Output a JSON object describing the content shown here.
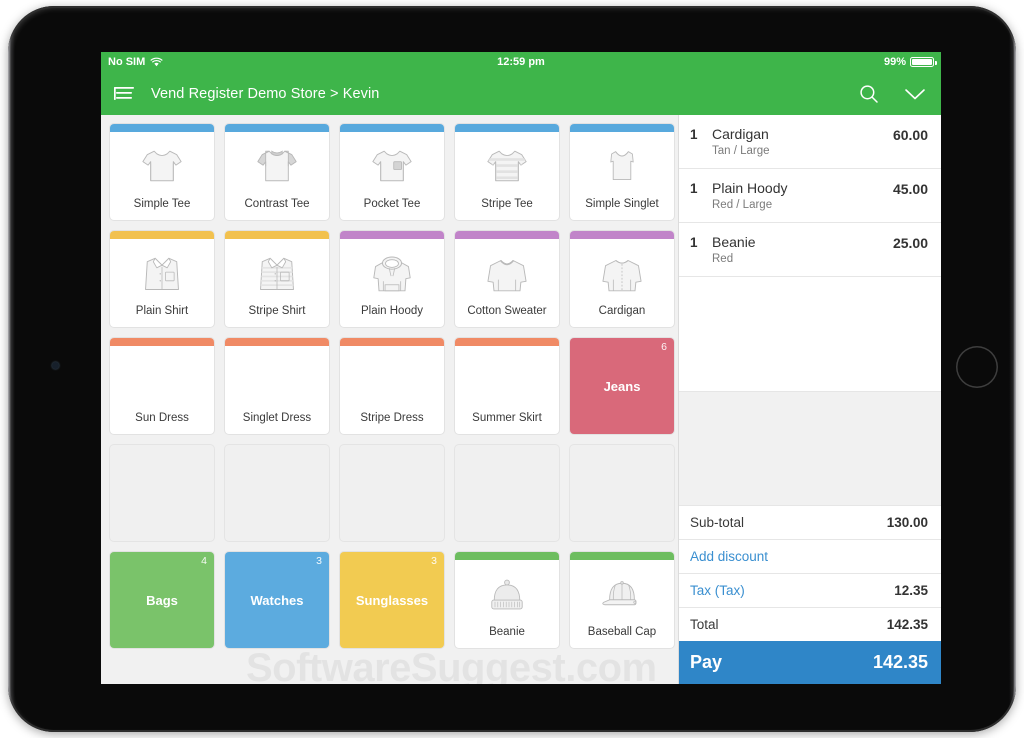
{
  "status_bar": {
    "carrier": "No SIM",
    "wifi_icon": "wifi-icon",
    "time": "12:59 pm",
    "battery_percent": "99%",
    "battery_icon": "battery-icon"
  },
  "nav": {
    "menu_icon": "hamburger-menu-icon",
    "breadcrumb": "Vend Register Demo Store > Kevin",
    "search_icon": "search-icon",
    "chevron_icon": "chevron-down-icon"
  },
  "colors": {
    "brand_green": "#3eb54a",
    "accent_blue": "#58a9dd",
    "accent_yellow": "#f2c14e",
    "accent_purple": "#c184c9",
    "accent_orange": "#f08a65",
    "accent_green": "#6dbd5f",
    "tile_green": "#7ac36a",
    "tile_blue": "#5cabdf",
    "tile_yellow": "#f2cb51",
    "tile_rose": "#d9697a",
    "pay_blue": "#2f86c8",
    "link_blue": "#3a8fd0"
  },
  "grid": {
    "tiles": [
      {
        "label": "Simple Tee",
        "type": "product",
        "accent": "#58a9dd",
        "art": "tee-simple-icon",
        "badge": ""
      },
      {
        "label": "Contrast Tee",
        "type": "product",
        "accent": "#58a9dd",
        "art": "tee-contrast-icon",
        "badge": ""
      },
      {
        "label": "Pocket Tee",
        "type": "product",
        "accent": "#58a9dd",
        "art": "tee-pocket-icon",
        "badge": ""
      },
      {
        "label": "Stripe Tee",
        "type": "product",
        "accent": "#58a9dd",
        "art": "tee-stripe-icon",
        "badge": ""
      },
      {
        "label": "Simple Singlet",
        "type": "product",
        "accent": "#58a9dd",
        "art": "singlet-icon",
        "badge": ""
      },
      {
        "label": "Plain Shirt",
        "type": "product",
        "accent": "#f2c14e",
        "art": "shirt-plain-icon",
        "badge": ""
      },
      {
        "label": "Stripe Shirt",
        "type": "product",
        "accent": "#f2c14e",
        "art": "shirt-stripe-icon",
        "badge": ""
      },
      {
        "label": "Plain Hoody",
        "type": "product",
        "accent": "#c184c9",
        "art": "hoody-icon",
        "badge": ""
      },
      {
        "label": "Cotton Sweater",
        "type": "product",
        "accent": "#c184c9",
        "art": "sweater-icon",
        "badge": ""
      },
      {
        "label": "Cardigan",
        "type": "product",
        "accent": "#c184c9",
        "art": "cardigan-icon",
        "badge": ""
      },
      {
        "label": "Sun Dress",
        "type": "product",
        "accent": "#f08a65",
        "art": "",
        "badge": ""
      },
      {
        "label": "Singlet Dress",
        "type": "product",
        "accent": "#f08a65",
        "art": "",
        "badge": ""
      },
      {
        "label": "Stripe Dress",
        "type": "product",
        "accent": "#f08a65",
        "art": "",
        "badge": ""
      },
      {
        "label": "Summer Skirt",
        "type": "product",
        "accent": "#f08a65",
        "art": "",
        "badge": ""
      },
      {
        "label": "Jeans",
        "type": "group",
        "accent": "#d9697a",
        "art": "",
        "badge": "6"
      },
      {
        "label": "",
        "type": "empty",
        "accent": "",
        "art": "",
        "badge": ""
      },
      {
        "label": "",
        "type": "empty",
        "accent": "",
        "art": "",
        "badge": ""
      },
      {
        "label": "",
        "type": "empty",
        "accent": "",
        "art": "",
        "badge": ""
      },
      {
        "label": "",
        "type": "empty",
        "accent": "",
        "art": "",
        "badge": ""
      },
      {
        "label": "",
        "type": "empty",
        "accent": "",
        "art": "",
        "badge": ""
      },
      {
        "label": "Bags",
        "type": "group",
        "accent": "#7ac36a",
        "art": "",
        "badge": "4"
      },
      {
        "label": "Watches",
        "type": "group",
        "accent": "#5cabdf",
        "art": "",
        "badge": "3"
      },
      {
        "label": "Sunglasses",
        "type": "group",
        "accent": "#f2cb51",
        "art": "",
        "badge": "3"
      },
      {
        "label": "Beanie",
        "type": "product",
        "accent": "#6dbd5f",
        "art": "beanie-icon",
        "badge": ""
      },
      {
        "label": "Baseball Cap",
        "type": "product",
        "accent": "#6dbd5f",
        "art": "cap-icon",
        "badge": ""
      }
    ]
  },
  "cart": {
    "items": [
      {
        "qty": "1",
        "name": "Cardigan",
        "variant": "Tan / Large",
        "price": "60.00"
      },
      {
        "qty": "1",
        "name": "Plain Hoody",
        "variant": "Red / Large",
        "price": "45.00"
      },
      {
        "qty": "1",
        "name": "Beanie",
        "variant": "Red",
        "price": "25.00"
      }
    ],
    "totals": [
      {
        "label": "Sub-total",
        "amount": "130.00",
        "style": "plain"
      },
      {
        "label": "Add discount",
        "amount": "",
        "style": "link"
      },
      {
        "label": "Tax (Tax)",
        "amount": "12.35",
        "style": "tax"
      },
      {
        "label": "Total",
        "amount": "142.35",
        "style": "plain"
      }
    ],
    "pay": {
      "label": "Pay",
      "amount": "142.35"
    }
  },
  "watermark": "SoftwareSuggest.com"
}
